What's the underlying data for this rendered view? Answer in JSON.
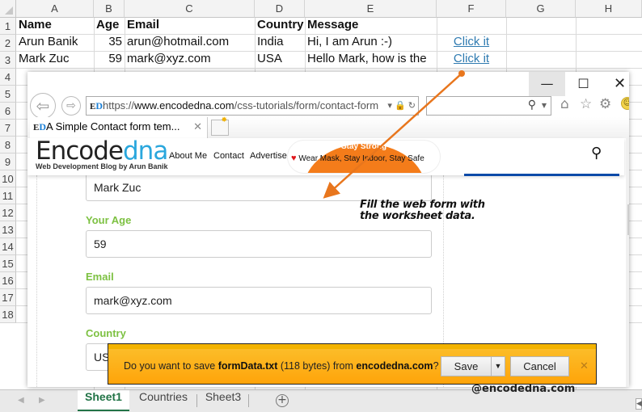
{
  "excel": {
    "columns": [
      "A",
      "B",
      "C",
      "D",
      "E",
      "F",
      "G",
      "H"
    ],
    "rows": [
      "1",
      "2",
      "3",
      "4",
      "5",
      "6",
      "7",
      "8",
      "9",
      "10",
      "11",
      "12",
      "13",
      "14",
      "15",
      "16",
      "17",
      "18"
    ],
    "header_row": {
      "name": "Name",
      "age": "Age",
      "email": "Email",
      "country": "Country",
      "message": "Message"
    },
    "data_rows": [
      {
        "name": "Arun Banik",
        "age": "35",
        "email": "arun@hotmail.com",
        "country": "India",
        "message": "Hi, I am Arun :-)",
        "link": "Click it"
      },
      {
        "name": "Mark Zuc",
        "age": "59",
        "email": "mark@xyz.com",
        "country": "USA",
        "message": "Hello Mark, how is the",
        "link": "Click it"
      }
    ],
    "sheet_tabs": [
      {
        "label": "Sheet1",
        "active": true
      },
      {
        "label": "Countries",
        "active": false
      },
      {
        "label": "Sheet3",
        "active": false
      }
    ],
    "add_sheet": "+"
  },
  "browser": {
    "window_controls": {
      "minimize": "—",
      "maximize": "☐",
      "close": "✕"
    },
    "favicon": "E",
    "favicon_d": "D",
    "url_scheme": "https://",
    "url_host": "www.encodedna.com",
    "url_path": "/css-tutorials/form/contact-form",
    "tab_title": "A Simple Contact form tem...",
    "site": {
      "logo_main": "Encode",
      "logo_accent": "dna",
      "tagline": "Web Development Blog by Arun Banik",
      "menu": [
        "About Me",
        "Contact",
        "Advertise"
      ],
      "banner_title": "Stay Strong",
      "banner_message": "Wear Mask, Stay Indoor, Stay Safe"
    },
    "form": {
      "name_value": "Mark Zuc",
      "age_label": "Your Age",
      "age_value": "59",
      "email_label": "Email",
      "email_value": "mark@xyz.com",
      "country_label": "Country",
      "country_value": "USA"
    },
    "download_bar": {
      "prefix": "Do you want to save ",
      "filename": "formData.txt",
      "size": " (118 bytes) from ",
      "domain": "encodedna.com",
      "suffix": "?",
      "save_label": "Save",
      "cancel_label": "Cancel"
    }
  },
  "annotation": {
    "line1": "Fill the web form with",
    "line2": "the worksheet data.",
    "arrow_color": "#e8761d"
  },
  "watermark": "@encodedna.com"
}
